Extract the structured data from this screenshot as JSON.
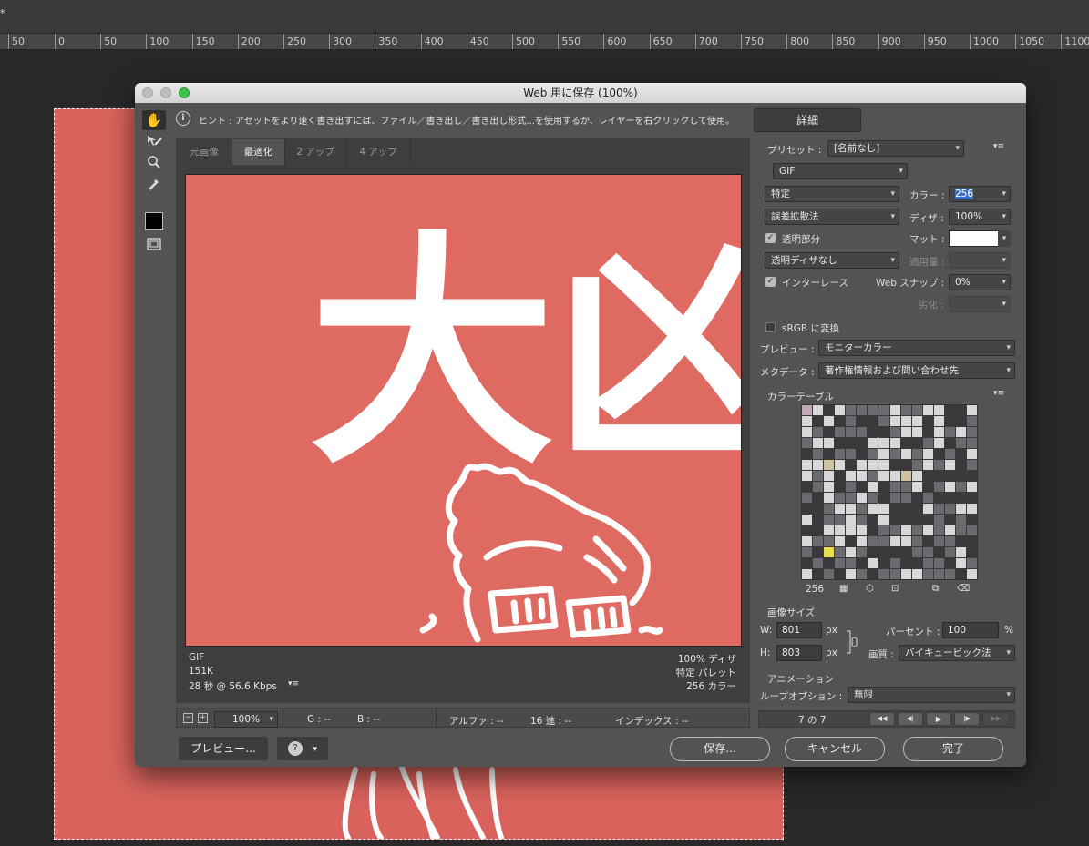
{
  "app": {
    "doc_tab": "*",
    "ruler_ticks": [
      "50",
      "0",
      "50",
      "100",
      "150",
      "200",
      "250",
      "300",
      "350",
      "400",
      "450",
      "500",
      "550",
      "600",
      "650",
      "700",
      "750",
      "800",
      "850",
      "900",
      "950",
      "1000",
      "1050",
      "1100"
    ]
  },
  "dialog": {
    "title": "Web 用に保存 (100%)",
    "hint": "ヒント : アセットをより速く書き出すには、ファイル／書き出し／書き出し形式...を使用するか、レイヤーを右クリックして使用。",
    "details_button": "詳細",
    "tabs": [
      "元画像",
      "最適化",
      "2 アップ",
      "4 アップ"
    ],
    "active_tab": 1,
    "preview_text": "大凶",
    "preview_info": {
      "format": "GIF",
      "size": "151K",
      "time": "28 秒 @ 56.6 Kbps",
      "dither": "100% ディザ",
      "palette": "特定 パレット",
      "colors": "256 カラー"
    },
    "status_bar": {
      "zoom": "100%",
      "g": "G : --",
      "b": "B : --",
      "alpha": "アルファ : --",
      "hex": "16 進 : --",
      "index": "インデックス : --"
    },
    "buttons": {
      "preview": "プレビュー...",
      "save": "保存...",
      "cancel": "キャンセル",
      "done": "完了"
    }
  },
  "settings": {
    "preset_label": "プリセット :",
    "preset_value": "[名前なし]",
    "format": "GIF",
    "reduction": "特定",
    "colors_label": "カラー :",
    "colors_value": "256",
    "dither_algo": "誤差拡散法",
    "dither_label": "ディザ :",
    "dither_value": "100%",
    "transparency_label": "透明部分",
    "transparency_checked": true,
    "matte_label": "マット :",
    "trans_dither": "透明ディザなし",
    "amount_label": "適用量 :",
    "interlace_label": "インターレース",
    "interlace_checked": true,
    "websnap_label": "Web スナップ :",
    "websnap_value": "0%",
    "lossy_label": "劣化 :",
    "srgb_label": "sRGB に変換",
    "srgb_checked": false,
    "preview_label": "プレビュー :",
    "preview_value": "モニターカラー",
    "metadata_label": "メタデータ :",
    "metadata_value": "著作権情報および問い合わせ先",
    "color_table_label": "カラーテーブル",
    "color_count": "256",
    "image_size_label": "画像サイズ",
    "w_label": "W:",
    "w_value": "801",
    "h_label": "H:",
    "h_value": "803",
    "px": "px",
    "percent_label": "パーセント :",
    "percent_value": "100",
    "percent_unit": "%",
    "quality_label": "画質 :",
    "quality_value": "バイキュービック法",
    "animation_label": "アニメーション",
    "loop_label": "ループオプション :",
    "loop_value": "無限",
    "frame_counter": "7 の 7"
  },
  "icons": {
    "hand": "✋",
    "zoom": "⌕",
    "eyedropper": "✎",
    "info": "i",
    "menu": "▾≡",
    "first": "◀◀",
    "prev": "◀|",
    "play": "▶",
    "next": "|▶",
    "last": "▶▶"
  }
}
